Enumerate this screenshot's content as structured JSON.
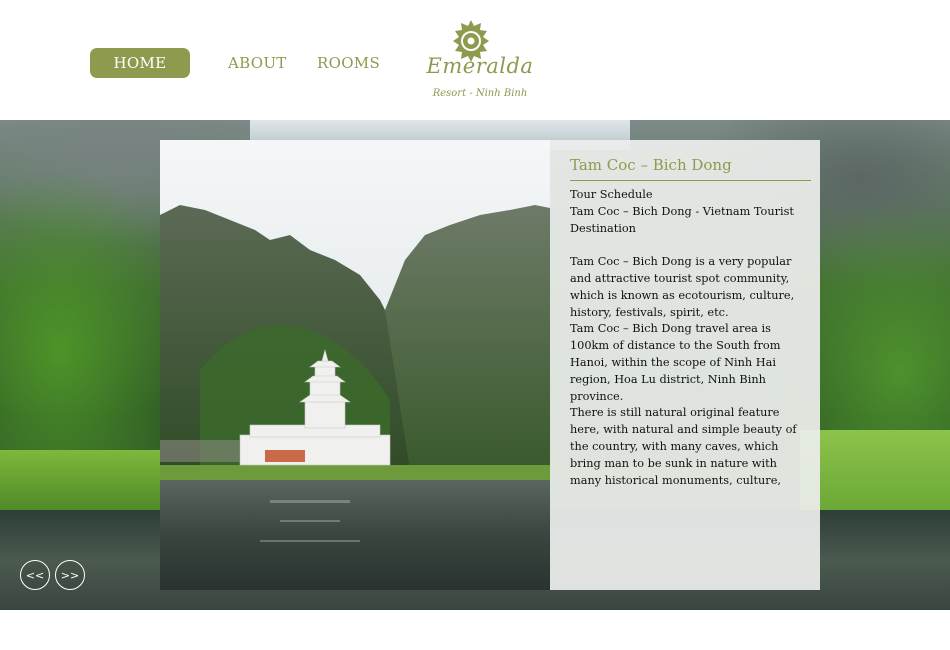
{
  "nav": {
    "items": [
      {
        "label": "HOME",
        "active": true
      },
      {
        "label": "ABOUT",
        "active": false
      },
      {
        "label": "ROOMS",
        "active": false
      }
    ]
  },
  "logo": {
    "name": "Emeralda",
    "subtitle": "Resort - Ninh Binh",
    "icon": "sun-flower-icon"
  },
  "slide": {
    "title": "Tam Coc – Bich Dong",
    "heading": "Tour Schedule",
    "subheading": "Tam Coc – Bich Dong -  Vietnam Tourist Destination",
    "paragraphs": [
      "Tam Coc – Bich Dong is a very popular and attractive tourist spot community, which is known as ecotourism, culture, history, festivals, spirit, etc.",
      "Tam Coc – Bich Dong travel area is 100km of distance to the South from Hanoi, within the scope of Ninh Hai region, Hoa Lu district, Ninh Binh province.",
      "There is still natural original feature here, with natural and simple beauty of the country, with many caves, which bring man to be sunk in nature with many historical monuments, culture,"
    ]
  },
  "slider_controls": {
    "prev_label": "<<",
    "next_label": ">>"
  },
  "colors": {
    "accent": "#8e9a4e",
    "panel_bg": "#eceeec",
    "text": "#111111"
  }
}
